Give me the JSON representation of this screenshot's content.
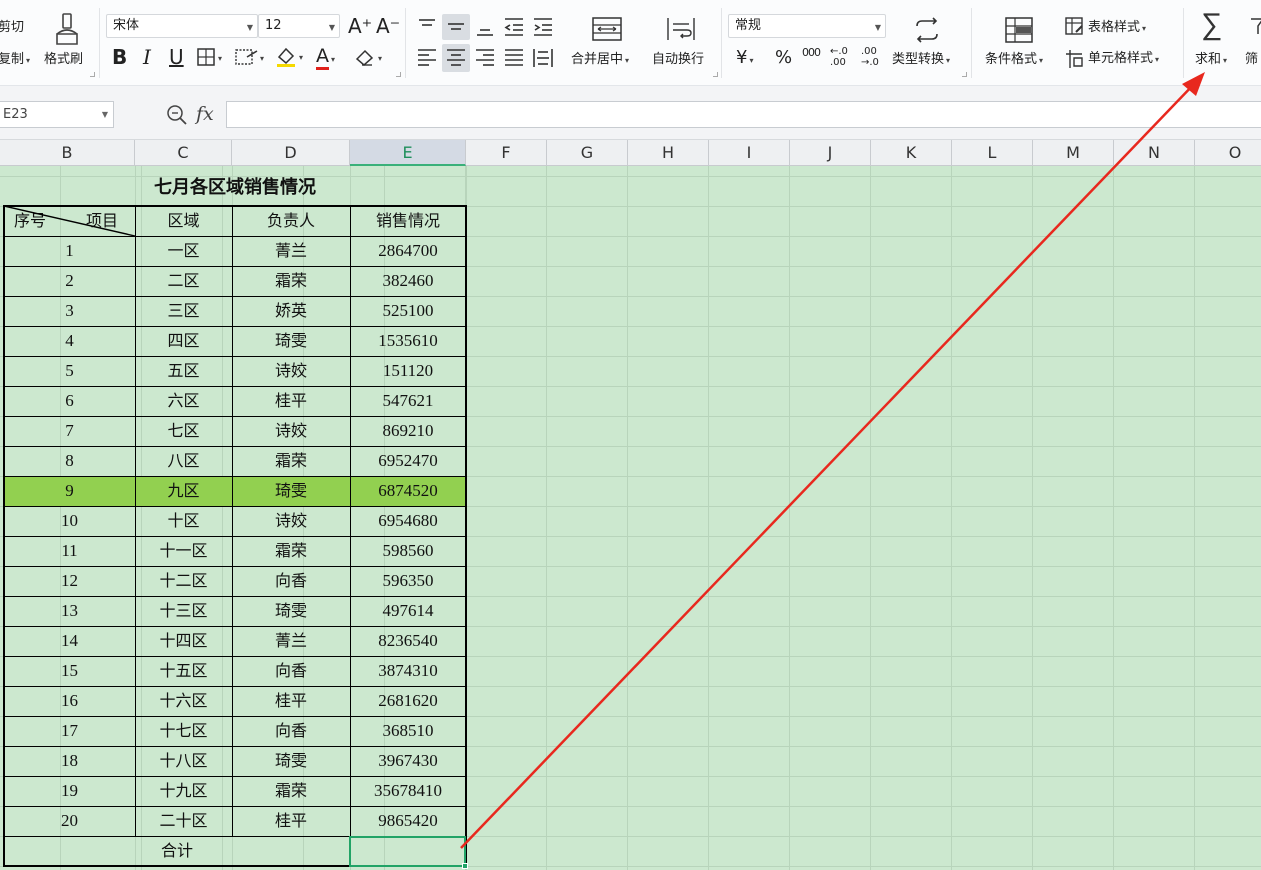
{
  "ribbon": {
    "clipboard": {
      "cut": "剪切",
      "copy": "复制",
      "format_painter": "格式刷"
    },
    "font": {
      "name": "宋体",
      "size": "12",
      "bold": "B",
      "italic": "I",
      "underline": "U",
      "grow": "A⁺",
      "shrink": "A⁻",
      "font_color_letter": "A",
      "font_color": "#e0201b",
      "fill_color": "#f5d900"
    },
    "align": {
      "merge_center": "合并居中",
      "wrap_text": "自动换行"
    },
    "number": {
      "format": "常规",
      "currency": "¥",
      "percent": "%",
      "thousands": "000",
      "inc_decimal": "←.0 .00",
      "dec_decimal": ".00 →.0",
      "type_convert": "类型转换"
    },
    "styles": {
      "conditional": "条件格式",
      "table_style": "表格样式",
      "cell_style": "单元格样式"
    },
    "editing": {
      "sum_symbol": "∑",
      "sum": "求和",
      "filter": "筛"
    }
  },
  "formula_bar": {
    "name_box": "E23",
    "fx": "fx",
    "value": ""
  },
  "columns": [
    {
      "label": "B",
      "active": false
    },
    {
      "label": "C",
      "active": false
    },
    {
      "label": "D",
      "active": false
    },
    {
      "label": "E",
      "active": true
    },
    {
      "label": "F",
      "active": false
    },
    {
      "label": "G",
      "active": false
    },
    {
      "label": "H",
      "active": false
    },
    {
      "label": "I",
      "active": false
    },
    {
      "label": "J",
      "active": false
    },
    {
      "label": "K",
      "active": false
    },
    {
      "label": "L",
      "active": false
    },
    {
      "label": "M",
      "active": false
    },
    {
      "label": "N",
      "active": false
    },
    {
      "label": "O",
      "active": false
    }
  ],
  "table": {
    "title": "七月各区域销售情况",
    "header": {
      "seq": "序号",
      "item": "项目",
      "region": "区域",
      "manager": "负责人",
      "sales": "销售情况"
    },
    "rows": [
      {
        "seq": "1",
        "region": "一区",
        "manager": "菁兰",
        "sales": "2864700"
      },
      {
        "seq": "2",
        "region": "二区",
        "manager": "霜荣",
        "sales": "382460"
      },
      {
        "seq": "3",
        "region": "三区",
        "manager": "娇英",
        "sales": "525100"
      },
      {
        "seq": "4",
        "region": "四区",
        "manager": "琦雯",
        "sales": "1535610"
      },
      {
        "seq": "5",
        "region": "五区",
        "manager": "诗姣",
        "sales": "151120"
      },
      {
        "seq": "6",
        "region": "六区",
        "manager": "桂平",
        "sales": "547621"
      },
      {
        "seq": "7",
        "region": "七区",
        "manager": "诗姣",
        "sales": "869210"
      },
      {
        "seq": "8",
        "region": "八区",
        "manager": "霜荣",
        "sales": "6952470"
      },
      {
        "seq": "9",
        "region": "九区",
        "manager": "琦雯",
        "sales": "6874520",
        "highlight": true
      },
      {
        "seq": "10",
        "region": "十区",
        "manager": "诗姣",
        "sales": "6954680"
      },
      {
        "seq": "11",
        "region": "十一区",
        "manager": "霜荣",
        "sales": "598560"
      },
      {
        "seq": "12",
        "region": "十二区",
        "manager": "向香",
        "sales": "596350"
      },
      {
        "seq": "13",
        "region": "十三区",
        "manager": "琦雯",
        "sales": "497614"
      },
      {
        "seq": "14",
        "region": "十四区",
        "manager": "菁兰",
        "sales": "8236540"
      },
      {
        "seq": "15",
        "region": "十五区",
        "manager": "向香",
        "sales": "3874310"
      },
      {
        "seq": "16",
        "region": "十六区",
        "manager": "桂平",
        "sales": "2681620"
      },
      {
        "seq": "17",
        "region": "十七区",
        "manager": "向香",
        "sales": "368510"
      },
      {
        "seq": "18",
        "region": "十八区",
        "manager": "琦雯",
        "sales": "3967430"
      },
      {
        "seq": "19",
        "region": "十九区",
        "manager": "霜荣",
        "sales": "35678410"
      },
      {
        "seq": "20",
        "region": "二十区",
        "manager": "桂平",
        "sales": "9865420"
      }
    ],
    "total_label": "合计",
    "total_value": ""
  },
  "colors": {
    "sheet_bg": "#cce8cf",
    "highlight_row": "#92d050",
    "selection": "#21a366",
    "annotation_arrow": "#e8281e"
  }
}
